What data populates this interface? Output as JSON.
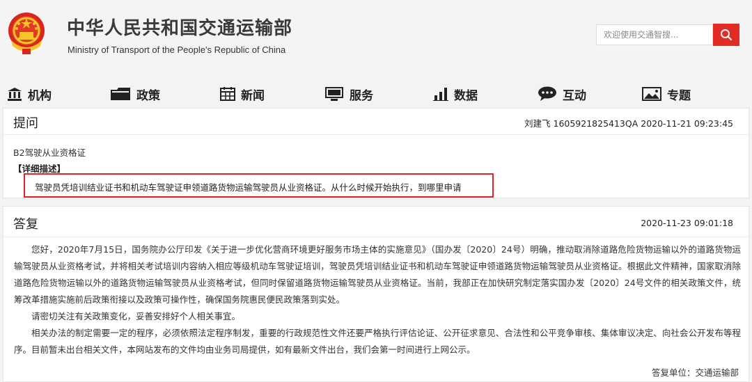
{
  "header": {
    "title_cn": "中华人民共和国交通运输部",
    "title_en": "Ministry of Transport of the People's Republic of China",
    "search_placeholder": "欢迎使用交通智搜...",
    "brand_red": "#e22b24"
  },
  "nav": {
    "items": [
      {
        "label": "机构",
        "icon": "building-icon"
      },
      {
        "label": "政策",
        "icon": "folder-icon"
      },
      {
        "label": "新闻",
        "icon": "calendar-grid-icon"
      },
      {
        "label": "服务",
        "icon": "monitor-icon"
      },
      {
        "label": "数据",
        "icon": "bar-chart-icon"
      },
      {
        "label": "互动",
        "icon": "chat-bubble-icon"
      },
      {
        "label": "专题",
        "icon": "picture-icon"
      }
    ]
  },
  "question": {
    "heading": "提问",
    "meta": "刘建飞 1605921825413QA  2020-11-21 09:23:45",
    "subject": "B2驾驶从业资格证",
    "detail_label": "【详细描述】",
    "detail_text": "驾驶员凭培训结业证书和机动车驾驶证申领道路货物运输驾驶员从业资格证。从什么时候开始执行，到哪里申请",
    "highlight_color": "#e8202a"
  },
  "answer": {
    "heading": "答复",
    "time": "2020-11-23 09:01:18",
    "paragraphs": [
      "您好，2020年7月15日，国务院办公厅印发《关于进一步优化营商环境更好服务市场主体的实施意见》（国办发〔2020〕24号）明确，推动取消除道路危险货物运输以外的道路货物运输驾驶员从业资格考试，并将相关考试培训内容纳入相应等级机动车驾驶证培训，驾驶员凭培训结业证书和机动车驾驶证申领道路货物运输驾驶员从业资格证。根据此文件精神，国家取消除道路危险货物运输以外的道路货物运输驾驶员从业资格考试，但同时保留道路货物运输驾驶员从业资格证。当前，我部正在加快研究制定落实国办发〔2020〕24号文件的相关政策文件，统筹改革措施实施前后政策衔接以及政策可操作性，确保国务院惠民便民政策落到实处。",
      "请密切关注有关政策变化，妥善安排好个人相关事宜。",
      "相关办法的制定需要一定的程序，必须依照法定程序制发，重要的行政规范性文件还要严格执行评估论证、公开征求意见、合法性和公平竞争审核、集体审议决定、向社会公开发布等程序。目前暂未出台相关文件，本网站发布的文件均由业务司局提供，如有最新文件出台，我们会第一时间进行上网公示。"
    ],
    "unit": "答复单位：交通运输部"
  }
}
